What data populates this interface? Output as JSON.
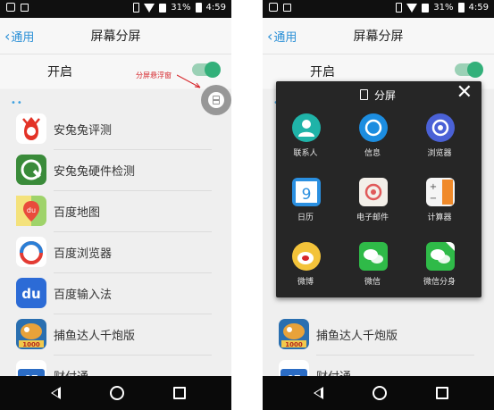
{
  "status_bar": {
    "battery": "31%",
    "time": "4:59"
  },
  "header": {
    "back_label": "通用",
    "title": "屏幕分屏"
  },
  "toggle": {
    "label": "开启",
    "state": "on"
  },
  "annotation": {
    "text": "分屏悬浮窗"
  },
  "apps": [
    {
      "label": "安兔兔评测"
    },
    {
      "label": "安兔兔硬件检测"
    },
    {
      "label": "百度地图"
    },
    {
      "label": "百度浏览器"
    },
    {
      "label": "百度输入法"
    },
    {
      "label": "捕鱼达人千炮版"
    },
    {
      "label": "财付通"
    }
  ],
  "split_panel": {
    "title": "分屏",
    "apps": [
      {
        "label": "联系人"
      },
      {
        "label": "信息"
      },
      {
        "label": "浏览器"
      },
      {
        "label": "日历"
      },
      {
        "label": "电子邮件"
      },
      {
        "label": "计算器"
      },
      {
        "label": "微博"
      },
      {
        "label": "微信"
      },
      {
        "label": "微信分身"
      }
    ]
  },
  "colors": {
    "accent": "#2a8fd6",
    "toggle_on": "#33b07a",
    "annotation": "#d6262b"
  }
}
